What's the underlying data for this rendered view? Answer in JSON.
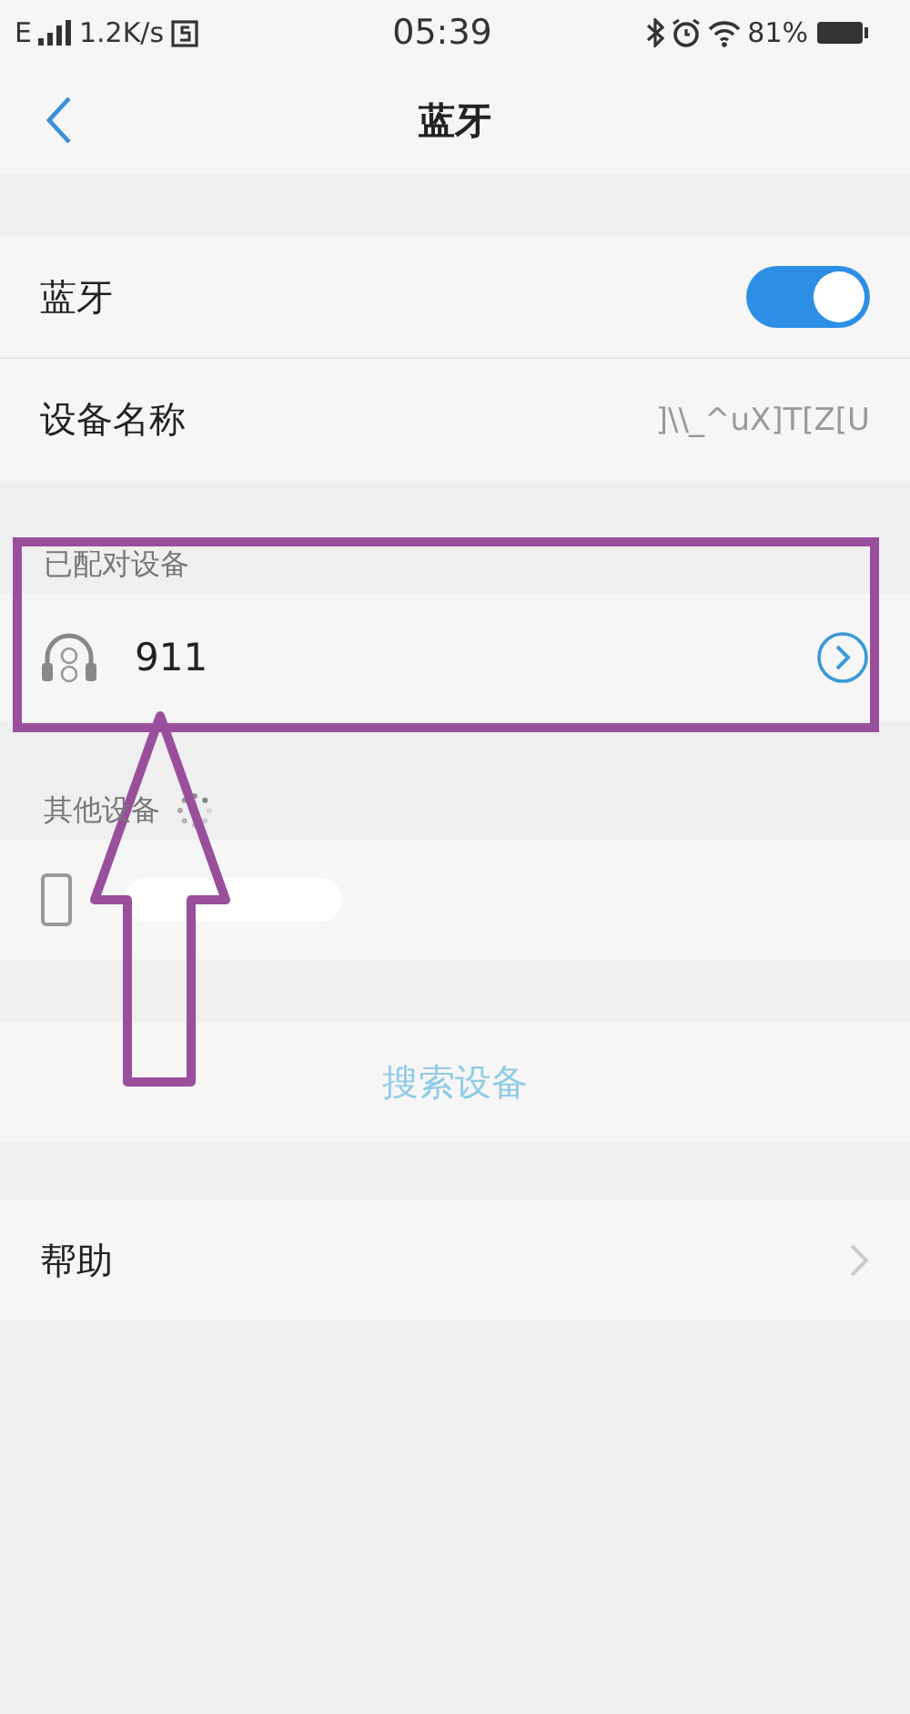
{
  "status_bar": {
    "network": "E",
    "speed": "1.2K/s",
    "time": "05:39",
    "battery": "81%"
  },
  "nav": {
    "title": "蓝牙"
  },
  "settings": [
    {
      "kind": "toggle",
      "label": "蓝牙",
      "on": true
    },
    {
      "kind": "value",
      "label": "设备名称",
      "value": "]\\\\_^uX]T[Z[U"
    }
  ],
  "paired": {
    "header": "已配对设备",
    "devices": [
      {
        "name": "911"
      }
    ]
  },
  "other": {
    "header": "其他设备",
    "devices": [
      {
        "kind": "phone"
      }
    ]
  },
  "search_button": "搜索设备",
  "help": {
    "label": "帮助"
  }
}
